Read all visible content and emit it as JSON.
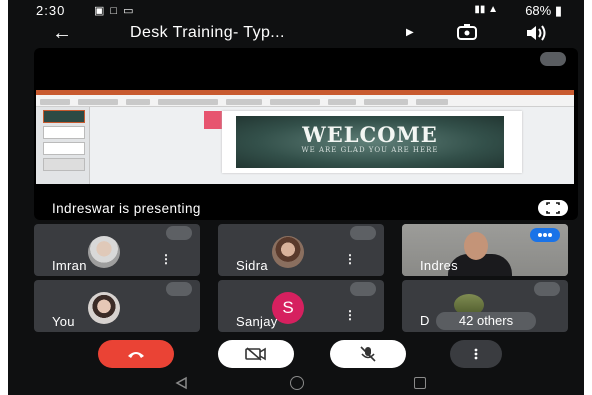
{
  "status_bar": {
    "time": "2:30",
    "battery": "68%",
    "icons": [
      "video-notification-icon",
      "square-notification-icon",
      "cast-icon",
      "vibrate-icon",
      "signal-icon",
      "battery-icon"
    ]
  },
  "meeting": {
    "title": "Desk Training- Typ...",
    "presenting_text": "Indreswar is presenting"
  },
  "slide": {
    "heading": "WELCOME",
    "subheading": "WE ARE GLAD YOU ARE HERE"
  },
  "participants": [
    {
      "name": "Imran",
      "muted": true
    },
    {
      "name": "Sidra",
      "muted": true
    },
    {
      "name": "Indres",
      "muted": false,
      "speaking": true
    },
    {
      "name": "You",
      "muted": true
    },
    {
      "name": "Sanjay",
      "initial": "S",
      "muted": true
    },
    {
      "name": "D",
      "others_label": "42 others",
      "muted": true
    }
  ],
  "colors": {
    "end_call": "#ea4335",
    "speaking": "#1a73e8",
    "avatar_sanjay": "#d6205f",
    "background": "#0f1011"
  }
}
